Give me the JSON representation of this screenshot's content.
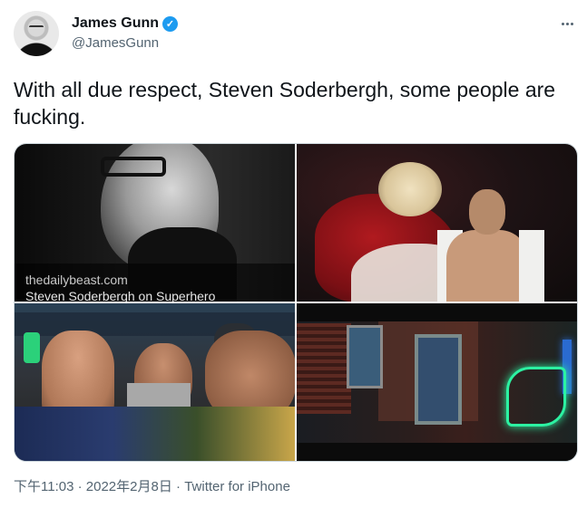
{
  "author": {
    "display_name": "James Gunn",
    "handle": "@JamesGunn",
    "verified": true
  },
  "tweet": {
    "text": "With all due respect, Steven Soderbergh, some people are fucking."
  },
  "media": {
    "link_card": {
      "source": "thedailybeast.com",
      "title": "Steven Soderbergh on Superhero"
    }
  },
  "meta": {
    "time": "下午11:03",
    "separator": " · ",
    "date": "2022年2月8日",
    "client": "Twitter for iPhone"
  },
  "colors": {
    "text": "#0f1419",
    "secondary": "#536471",
    "verified_blue": "#1d9bf0",
    "border": "#cfd9de"
  },
  "icons": {
    "verified": "verified-badge-icon",
    "more": "more-horizontal-icon"
  }
}
